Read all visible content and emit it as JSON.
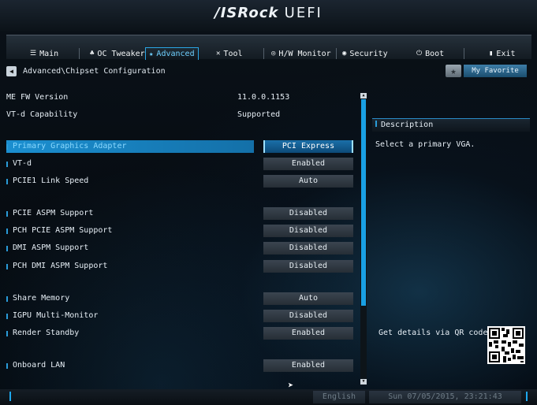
{
  "header": {
    "logo_brand": "/ISRock",
    "logo_product": "UEFI"
  },
  "tabs": [
    {
      "label": "Main",
      "icon": "list-icon",
      "glyph": "☰"
    },
    {
      "label": "OC Tweaker",
      "icon": "rocket-icon",
      "glyph": "♣"
    },
    {
      "label": "Advanced",
      "icon": "star-icon",
      "glyph": "★",
      "active": true
    },
    {
      "label": "Tool",
      "icon": "tool-icon",
      "glyph": "✕"
    },
    {
      "label": "H/W Monitor",
      "icon": "monitor-icon",
      "glyph": "◎"
    },
    {
      "label": "Security",
      "icon": "shield-icon",
      "glyph": "◉"
    },
    {
      "label": "Boot",
      "icon": "power-icon",
      "glyph": "⏻"
    },
    {
      "label": "Exit",
      "icon": "exit-icon",
      "glyph": "▮"
    }
  ],
  "breadcrumb": {
    "text": "Advanced\\Chipset Configuration"
  },
  "favorite": {
    "label": "My Favorite"
  },
  "info": [
    {
      "label": "ME FW Version",
      "value": "11.0.0.1153"
    },
    {
      "label": "VT-d Capability",
      "value": "Supported"
    }
  ],
  "settings": [
    {
      "label": "Primary Graphics Adapter",
      "value": "PCI Express",
      "selected": true
    },
    {
      "label": "VT-d",
      "value": "Enabled"
    },
    {
      "label": "PCIE1 Link Speed",
      "value": "Auto"
    },
    {
      "label": "PCIE ASPM Support",
      "value": "Disabled"
    },
    {
      "label": "PCH PCIE ASPM Support",
      "value": "Disabled"
    },
    {
      "label": "DMI ASPM Support",
      "value": "Disabled"
    },
    {
      "label": "PCH DMI ASPM Support",
      "value": "Disabled"
    },
    {
      "label": "Share Memory",
      "value": "Auto"
    },
    {
      "label": "IGPU Multi-Monitor",
      "value": "Disabled"
    },
    {
      "label": "Render Standby",
      "value": "Enabled"
    },
    {
      "label": "Onboard LAN",
      "value": "Enabled"
    }
  ],
  "description": {
    "title": "Description",
    "text": "Select a primary VGA.",
    "qr_text": "Get details via QR code"
  },
  "footer": {
    "language": "English",
    "datetime": "Sun 07/05/2015, 23:21:43"
  },
  "colors": {
    "accent": "#1da8ee",
    "selected_row": "#1b8fd0"
  }
}
